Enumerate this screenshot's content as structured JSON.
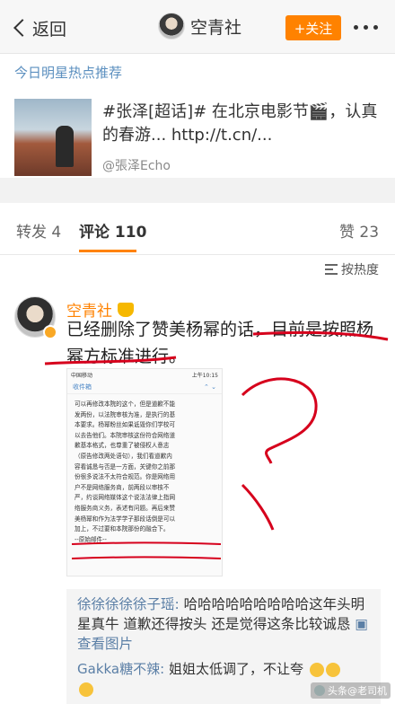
{
  "header": {
    "back_label": "返回",
    "title": "空青社",
    "follow_label": "+关注"
  },
  "recommend": {
    "section_title": "今日明星热点推荐",
    "post_text": "#张泽[超话]# 在北京电影节🎬，认真的春游... http://t.cn/...",
    "handle": "@張泽Echo"
  },
  "tabs": {
    "repost": "转发 4",
    "comment": "评论 110",
    "like": "赞 23"
  },
  "sort_label": "按热度",
  "comment": {
    "author": "空青社",
    "text": "已经删除了赞美杨幂的话，目前是按照杨幂方标准进行。",
    "screenshot": {
      "carrier": "中国移动",
      "time": "上午10:15",
      "nav": "收件箱",
      "body": "可以再修改本院的这个，但是道歉不能\n发两份，以法院审核为准，是执行的基\n本要求。杨幂粉丝如果诋毁你们学校可\n以去告他们。本院审核这份符合网络道\n歉基本格式，也尊重了被侵权人意志\n（原告修改两处语句），我们看道歉内\n容看诚恳与否是一方面，关键你之前那\n份很多说法不太符合规范。你是网络用\n户不是网络服务商，前两段以审核不\n严，约谈网络媒体这个说法法律上指网\n络服务商义务，表述有问题。再后来赞\n美杨幂和作为法学学子那段话倒是可以\n加上，不过要和本院那份的融合下。\n--原始邮件--"
    }
  },
  "replies": [
    {
      "author": "徐徐徐徐徐子瑶:",
      "text": " 哈哈哈哈哈哈哈哈哈这年头明星真牛 道歉还得按头 还是觉得这条比较诚恳 ",
      "link": "查看图片"
    },
    {
      "author": "Gakka糖不辣:",
      "text": " 姐姐太低调了，不让夸"
    }
  ],
  "watermark": "头条@老司机"
}
